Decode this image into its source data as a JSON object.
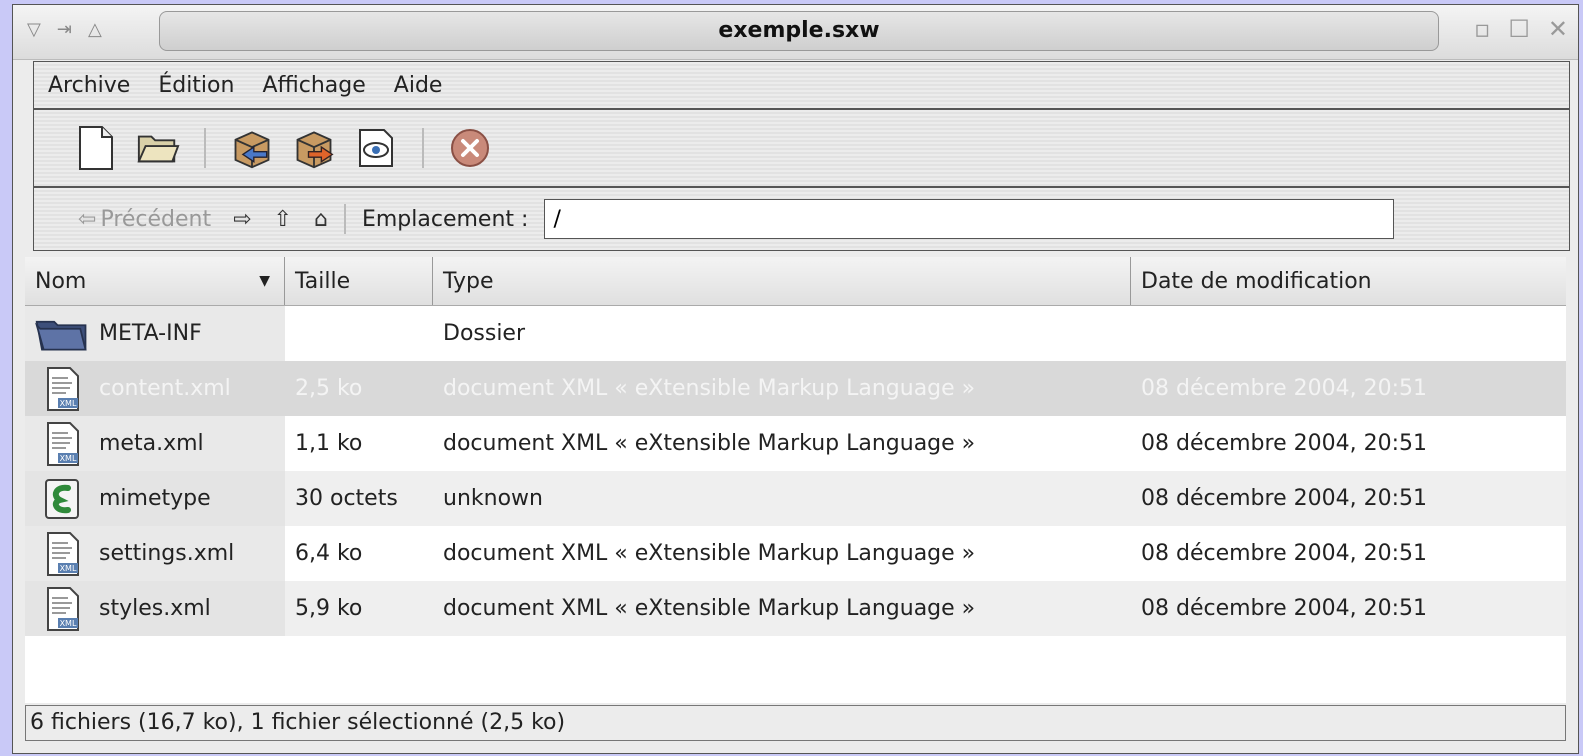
{
  "window": {
    "title": "exemple.sxw"
  },
  "menu": [
    "Archive",
    "Édition",
    "Affichage",
    "Aide"
  ],
  "location": {
    "back_label": "Précédent",
    "label": "Emplacement :",
    "value": "/"
  },
  "columns": {
    "name": "Nom",
    "size": "Taille",
    "type": "Type",
    "date": "Date de modification"
  },
  "files": [
    {
      "name": "META-INF",
      "size": "",
      "type": "Dossier",
      "date": "",
      "icon": "folder-icon"
    },
    {
      "name": "content.xml",
      "size": "2,5 ko",
      "type": "document XML « eXtensible Markup Language »",
      "date": "08 décembre 2004, 20:51",
      "icon": "xml-file-icon",
      "selected": true
    },
    {
      "name": "meta.xml",
      "size": "1,1 ko",
      "type": "document XML « eXtensible Markup Language »",
      "date": "08 décembre 2004, 20:51",
      "icon": "xml-file-icon"
    },
    {
      "name": "mimetype",
      "size": "30 octets",
      "type": "unknown",
      "date": "08 décembre 2004, 20:51",
      "icon": "unknown-file-icon"
    },
    {
      "name": "settings.xml",
      "size": "6,4 ko",
      "type": "document XML « eXtensible Markup Language »",
      "date": "08 décembre 2004, 20:51",
      "icon": "xml-file-icon"
    },
    {
      "name": "styles.xml",
      "size": "5,9 ko",
      "type": "document XML « eXtensible Markup Language »",
      "date": "08 décembre 2004, 20:51",
      "icon": "xml-file-icon"
    }
  ],
  "status": "6 fichiers (16,7 ko), 1 fichier sélectionné (2,5 ko)"
}
